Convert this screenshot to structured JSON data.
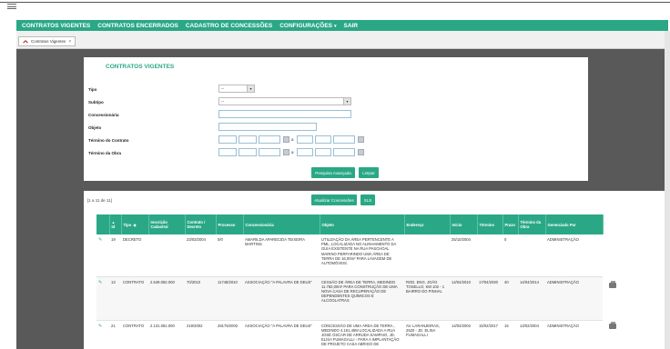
{
  "nav": {
    "items": [
      {
        "label": "CONTRATOS VIGENTES"
      },
      {
        "label": "CONTRATOS ENCERRADOS"
      },
      {
        "label": "CADASTRO DE CONCESSÕES"
      },
      {
        "label": "CONFIGURAÇÕES",
        "dropdown": true
      },
      {
        "label": "SAIR"
      }
    ],
    "color": "#2aa886"
  },
  "tab": {
    "label": "Contratos Vigentes",
    "close": "×",
    "icon": "up-chevron-icon"
  },
  "filter": {
    "title": "CONTRATOS VIGENTES",
    "tipo_label": "Tipo",
    "tipo_value": "--",
    "subtipo_label": "Subtipo",
    "subtipo_value": "--",
    "concessionaria_label": "Concessionária",
    "objeto_label": "Objeto",
    "termino_contrato_label": "Término do Contrato",
    "termino_obra_label": "Término da Obra",
    "range_sep": "a",
    "btn_advanced": "Pesquisa Avançada",
    "btn_clear": "Limpar"
  },
  "results": {
    "count_text": "[1 a 11 de 11]",
    "btn_update": "Atualizar Concessões",
    "btn_xls": "XLS",
    "columns": [
      "Id",
      "Tipo",
      "Inscrição Cadastral",
      "Contrato / Decreto",
      "Processo",
      "Concessionária",
      "Objeto",
      "Endereço",
      "Início",
      "Término",
      "Prazo",
      "Término da Obra",
      "Gerenciado Por"
    ],
    "rows": [
      {
        "id": "19",
        "tipo": "DECRETO",
        "inscricao": "",
        "contrato": "23/03/2004",
        "processo": "0/0",
        "concessionaria": "AMARILDA APARECIDA TEIXEIRA MARTINS",
        "objeto": "UTILIZAÇÃO DA ÁREA PERTENCENTE A PML, LOCALIZADA NO ALINHAMENTO DA GUIA EXISTENTE NA RUA PASCHOAL MARINO PERFARINDO UMA ÁREA DE TERRA DE 16,00m² PARA LAVAGEM DE AUTOMÓVEIS.",
        "endereco": "",
        "inicio": "25/10/2004",
        "termino": "",
        "prazo": "0",
        "termino_obra": "",
        "gerenciado": "ADMINISTRAÇÃO"
      },
      {
        "id": "13",
        "tipo": "CONTRATO",
        "inscricao": "2.549.082.000",
        "contrato": "70/2010",
        "processo": "11748/2010",
        "concessionaria": "ASSOCIAÇÃO \"A PALAVRA DE DEUS\"",
        "objeto": "CESSÃO DE ÁREA DE TERRA, MEDINDO 11.782,00m² PARA CONSTRUÇÃO DE UMA NOVA CASA DE RECUPERAÇÃO DE DEPENDENTES QUÍMICOS E ALCOOLATRAS",
        "endereco": "ROD. ENG. JOÃO TOSELLO, KM 102 - 1 BAIRRO DO PINHAL",
        "inicio": "14/04/2010",
        "termino": "17/04/2030",
        "prazo": "40",
        "termino_obra": "14/04/2014",
        "gerenciado": "ADMINISTRAÇÃO"
      },
      {
        "id": "21",
        "tipo": "CONTRATO",
        "inscricao": "2.131.081.000",
        "contrato": "219/2002",
        "processo": "28175/2002",
        "concessionaria": "ASSOCIAÇÃO \"A PALAVRA DE DEUS\"",
        "objeto": "CONCESSÃO DE UMA ÁREA DE TERRA , MEDINDO 4.161,45M LOCALIZADA A RUA JOSÉ OSCAR DE ARRUDA SAMPAIO, JD. ELISA FUMAGALLI - PARA A IMPLANTAÇÃO DE PROJETO CASA ABRIGO DE",
        "endereco": "AV. LARANJEIRAS, 2520 - JD. ELISA FUMAGALLI",
        "inicio": "14/02/2002",
        "termino": "15/02/2017",
        "prazo": "15",
        "termino_obra": "13/02/2004",
        "gerenciado": "ADMINISTRAÇÃO"
      }
    ]
  }
}
